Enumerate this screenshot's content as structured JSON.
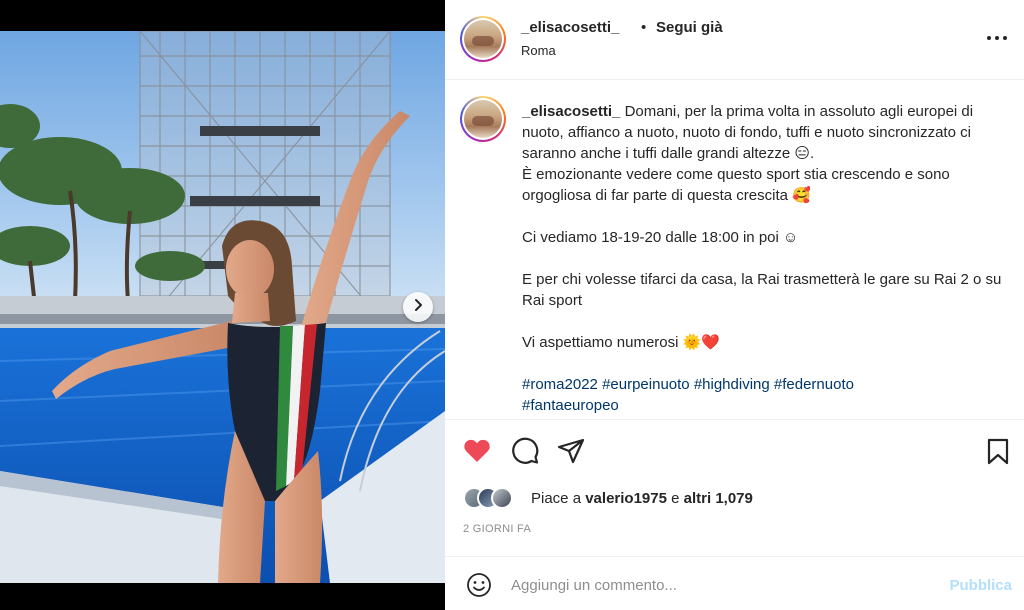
{
  "post": {
    "username": "_elisacosetti_",
    "separator": "•",
    "follow_label": "Segui già",
    "location": "Roma",
    "more_icon": "more-dots-icon"
  },
  "photo": {
    "description_icon": "post-photo",
    "next_icon": "chevron-right-icon"
  },
  "caption": {
    "username": "_elisacosetti_",
    "paragraph_1": "Domani, per la prima volta in assoluto agli europei di nuoto, affianco a nuoto, nuoto di fondo, tuffi e nuoto sincronizzato ci saranno anche i tuffi dalle grandi altezze 😑.",
    "paragraph_2": "È emozionante vedere come questo sport stia crescendo e sono orgogliosa di far parte di questa crescita 🥰",
    "paragraph_3": "Ci vediamo 18-19-20 dalle 18:00 in poi ☺",
    "paragraph_4": "E per chi volesse tifarci da casa, la Rai trasmetterà le gare su Rai 2 o su Rai sport",
    "paragraph_5": "Vi aspettiamo numerosi 🌞❤️",
    "hashtags": [
      "#roma2022",
      "#eurpeinuoto",
      "#highdiving",
      "#federnuoto",
      "#fantaeuropeo"
    ]
  },
  "actions": {
    "like_icon": "heart-filled-icon",
    "comment_icon": "comment-icon",
    "share_icon": "paper-plane-icon",
    "save_icon": "bookmark-icon",
    "like_color": "#ed4956"
  },
  "likes": {
    "prefix": "Piace a",
    "user": "valerio1975",
    "conjunction": "e",
    "others": "altri 1,079"
  },
  "timestamp": "2 GIORNI FA",
  "comment": {
    "placeholder": "Aggiungi un commento...",
    "publish_label": "Pubblica",
    "publish_color": "#b2dffc",
    "emoji_icon": "smiley-icon"
  }
}
